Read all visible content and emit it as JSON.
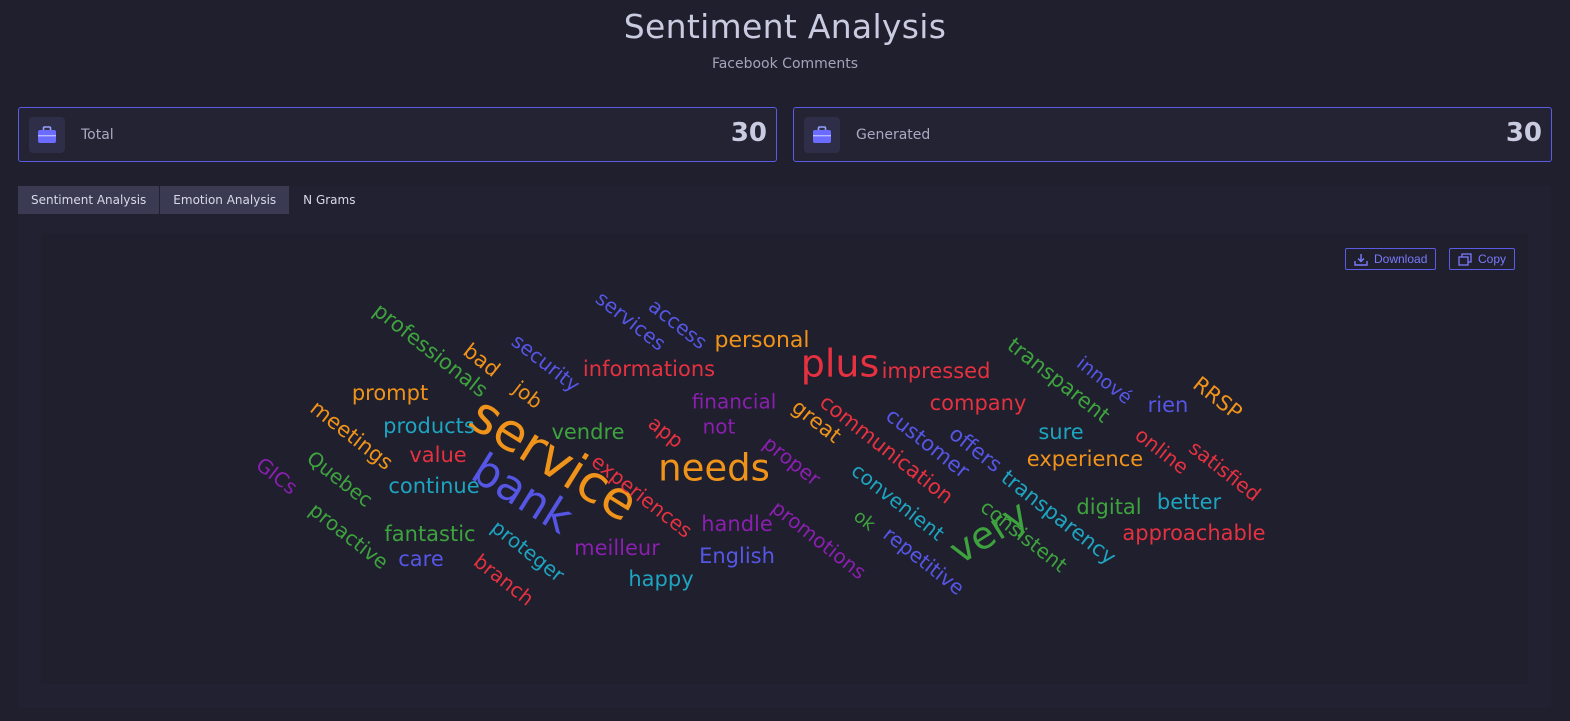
{
  "header": {
    "title": "Sentiment Analysis",
    "subtitle": "Facebook Comments"
  },
  "cards": [
    {
      "label": "Total",
      "value": "30",
      "icon": "briefcase-icon"
    },
    {
      "label": "Generated",
      "value": "30",
      "icon": "briefcase-icon"
    }
  ],
  "tabs": [
    "Sentiment Analysis",
    "Emotion Analysis",
    "N Grams"
  ],
  "toolbar": {
    "download_label": "Download",
    "copy_label": "Copy"
  },
  "colors": {
    "accent": "#5b5be6",
    "background": "#1f1f2e"
  },
  "wordcloud": {
    "words": [
      {
        "text": "service",
        "color": "#f0931a"
      },
      {
        "text": "bank",
        "color": "#5656e6"
      },
      {
        "text": "needs",
        "color": "#f0931a"
      },
      {
        "text": "plus",
        "color": "#e53140"
      },
      {
        "text": "very",
        "color": "#3ea33e"
      },
      {
        "text": "professionals",
        "color": "#3ea33e"
      },
      {
        "text": "services",
        "color": "#5656e6"
      },
      {
        "text": "access",
        "color": "#5656e6"
      },
      {
        "text": "personal",
        "color": "#f0931a"
      },
      {
        "text": "security",
        "color": "#5656e6"
      },
      {
        "text": "bad",
        "color": "#f0931a"
      },
      {
        "text": "informations",
        "color": "#e53140"
      },
      {
        "text": "impressed",
        "color": "#e53140"
      },
      {
        "text": "prompt",
        "color": "#f0931a"
      },
      {
        "text": "job",
        "color": "#f0931a"
      },
      {
        "text": "financial",
        "color": "#8b1fb0"
      },
      {
        "text": "company",
        "color": "#e53140"
      },
      {
        "text": "transparent",
        "color": "#3ea33e"
      },
      {
        "text": "innové",
        "color": "#5656e6"
      },
      {
        "text": "rien",
        "color": "#5656e6"
      },
      {
        "text": "RRSP",
        "color": "#f0931a"
      },
      {
        "text": "meetings",
        "color": "#f0931a"
      },
      {
        "text": "products",
        "color": "#1ea4c0"
      },
      {
        "text": "vendre",
        "color": "#3ea33e"
      },
      {
        "text": "app",
        "color": "#e53140"
      },
      {
        "text": "not",
        "color": "#8b1fb0"
      },
      {
        "text": "great",
        "color": "#f0931a"
      },
      {
        "text": "communication",
        "color": "#e53140"
      },
      {
        "text": "customer",
        "color": "#5656e6"
      },
      {
        "text": "offers",
        "color": "#5656e6"
      },
      {
        "text": "sure",
        "color": "#1ea4c0"
      },
      {
        "text": "online",
        "color": "#e53140"
      },
      {
        "text": "satisfied",
        "color": "#e53140"
      },
      {
        "text": "value",
        "color": "#e53140"
      },
      {
        "text": "proper",
        "color": "#8b1fb0"
      },
      {
        "text": "experience",
        "color": "#f0931a"
      },
      {
        "text": "GICs",
        "color": "#8b1fb0"
      },
      {
        "text": "Quebec",
        "color": "#3ea33e"
      },
      {
        "text": "continue",
        "color": "#1ea4c0"
      },
      {
        "text": "experiences",
        "color": "#e53140"
      },
      {
        "text": "convenient",
        "color": "#1ea4c0"
      },
      {
        "text": "transparency",
        "color": "#1ea4c0"
      },
      {
        "text": "digital",
        "color": "#3ea33e"
      },
      {
        "text": "better",
        "color": "#1ea4c0"
      },
      {
        "text": "proactive",
        "color": "#3ea33e"
      },
      {
        "text": "fantastic",
        "color": "#3ea33e"
      },
      {
        "text": "proteger",
        "color": "#1ea4c0"
      },
      {
        "text": "handle",
        "color": "#8b1fb0"
      },
      {
        "text": "promotions",
        "color": "#8b1fb0"
      },
      {
        "text": "ok",
        "color": "#3ea33e"
      },
      {
        "text": "consistent",
        "color": "#3ea33e"
      },
      {
        "text": "approachable",
        "color": "#e53140"
      },
      {
        "text": "care",
        "color": "#5656e6"
      },
      {
        "text": "meilleur",
        "color": "#8b1fb0"
      },
      {
        "text": "English",
        "color": "#5656e6"
      },
      {
        "text": "repetitive",
        "color": "#5656e6"
      },
      {
        "text": "branch",
        "color": "#e53140"
      },
      {
        "text": "happy",
        "color": "#1ea4c0"
      }
    ]
  }
}
